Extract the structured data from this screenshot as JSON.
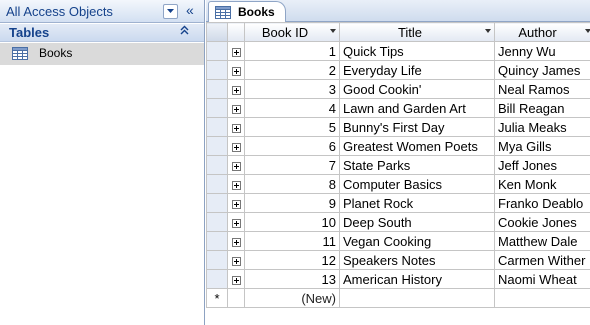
{
  "nav": {
    "title": "All Access Objects",
    "collapse_icon": "double-chevron-left",
    "group": {
      "title": "Tables",
      "chevron": "double-chevron-up"
    },
    "items": [
      {
        "label": "Books",
        "icon": "table-icon"
      }
    ]
  },
  "document": {
    "tab": {
      "label": "Books",
      "icon": "table-icon"
    },
    "columns": [
      {
        "label": "Book ID"
      },
      {
        "label": "Title"
      },
      {
        "label": "Author"
      }
    ],
    "rows": [
      {
        "id": "1",
        "title": "Quick Tips",
        "author": "Jenny Wu"
      },
      {
        "id": "2",
        "title": "Everyday Life",
        "author": "Quincy James"
      },
      {
        "id": "3",
        "title": "Good Cookin'",
        "author": "Neal Ramos"
      },
      {
        "id": "4",
        "title": "Lawn and Garden Art",
        "author": "Bill Reagan"
      },
      {
        "id": "5",
        "title": "Bunny's First Day",
        "author": "Julia Meaks"
      },
      {
        "id": "6",
        "title": "Greatest Women Poets",
        "author": "Mya Gills"
      },
      {
        "id": "7",
        "title": "State Parks",
        "author": "Jeff Jones"
      },
      {
        "id": "8",
        "title": "Computer Basics",
        "author": "Ken Monk"
      },
      {
        "id": "9",
        "title": "Planet Rock",
        "author": "Franko Deablo"
      },
      {
        "id": "10",
        "title": "Deep South",
        "author": "Cookie Jones"
      },
      {
        "id": "11",
        "title": "Vegan Cooking",
        "author": "Matthew Dale"
      },
      {
        "id": "12",
        "title": "Speakers Notes",
        "author": "Carmen Wither"
      },
      {
        "id": "13",
        "title": "American History",
        "author": "Naomi Wheat"
      }
    ],
    "new_row": {
      "marker": "*",
      "id_placeholder": "(New)"
    }
  },
  "colors": {
    "nav_text": "#15428b",
    "header_gradient_top": "#f3f7fc",
    "header_gradient_bottom": "#d3e0f2",
    "grid_line": "#c5c5c5",
    "selected_item": "#dadada"
  }
}
